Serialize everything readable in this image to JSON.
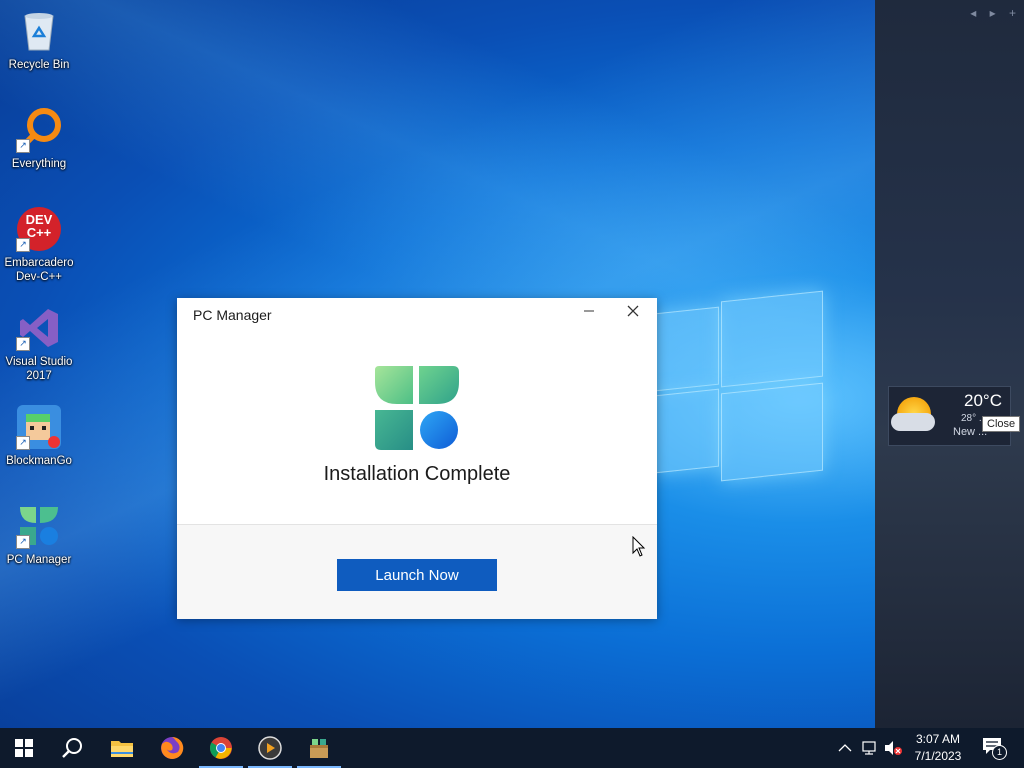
{
  "desktop": {
    "icons": [
      {
        "label": "Recycle Bin"
      },
      {
        "label": "Everything"
      },
      {
        "label": "Embarcadero Dev-C++"
      },
      {
        "label": "Visual Studio 2017"
      },
      {
        "label": "BlockmanGo"
      },
      {
        "label": "PC Manager"
      }
    ],
    "devcpp_logo_text": "DEV C++"
  },
  "dialog": {
    "title": "PC Manager",
    "heading": "Installation Complete",
    "launch_label": "Launch Now"
  },
  "widget": {
    "temperature": "20°C",
    "high_low": "28° ...",
    "city": "New ...",
    "tooltip": "Close"
  },
  "taskbar": {
    "apps": [
      "start-icon",
      "search-icon",
      "file-explorer-icon",
      "firefox-icon",
      "chrome-icon",
      "media-player-icon",
      "pc-manager-installer-icon"
    ],
    "time": "3:07 AM",
    "date": "7/1/2023",
    "notification_count": "1"
  },
  "colors": {
    "accent": "#0f5cbf",
    "taskbar": "#0e1a2c"
  }
}
